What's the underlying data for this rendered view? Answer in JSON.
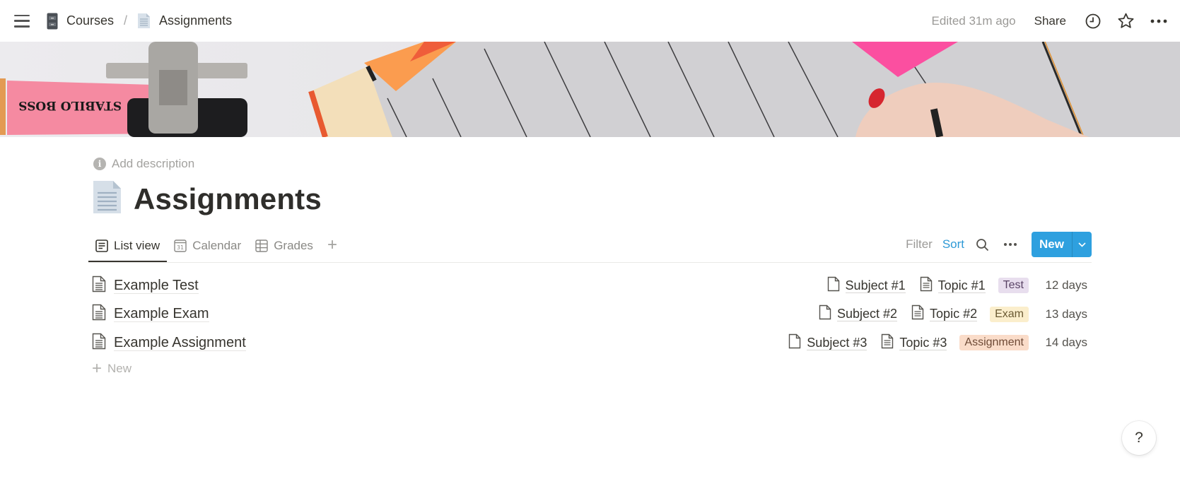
{
  "topbar": {
    "breadcrumbs": [
      {
        "label": "Courses",
        "icon": "file-cabinet-icon"
      },
      {
        "label": "Assignments",
        "icon": "page-icon"
      }
    ],
    "separator": "/",
    "edited": "Edited 31m ago",
    "share_label": "Share",
    "icons": [
      "history-clock-icon",
      "star-icon",
      "more-icon"
    ]
  },
  "page": {
    "add_description": "Add description",
    "title": "Assignments",
    "icon": "page-icon"
  },
  "views": {
    "tabs": [
      {
        "label": "List view",
        "icon": "list-icon",
        "active": true
      },
      {
        "label": "Calendar",
        "icon": "calendar-icon",
        "active": false
      },
      {
        "label": "Grades",
        "icon": "table-icon",
        "active": false
      }
    ],
    "add_view": "+",
    "calendar_icon_text": "31"
  },
  "toolbar": {
    "filter": "Filter",
    "sort": "Sort",
    "new_label": "New",
    "accent": "#2ea0df",
    "sort_color": "#2f9ad6"
  },
  "rows": [
    {
      "title": "Example Test",
      "subject": "Subject #1",
      "topic": "Topic #1",
      "type": "Test",
      "type_bg": "#e8deee",
      "type_fg": "#5a4466",
      "due": "12 days"
    },
    {
      "title": "Example Exam",
      "subject": "Subject #2",
      "topic": "Topic #2",
      "type": "Exam",
      "type_bg": "#fbeecc",
      "type_fg": "#6b5a33",
      "due": "13 days"
    },
    {
      "title": "Example Assignment",
      "subject": "Subject #3",
      "topic": "Topic #3",
      "type": "Assignment",
      "type_bg": "#fadcc9",
      "type_fg": "#6e4a36",
      "due": "14 days"
    }
  ],
  "new_row_label": "New",
  "help_label": "?"
}
